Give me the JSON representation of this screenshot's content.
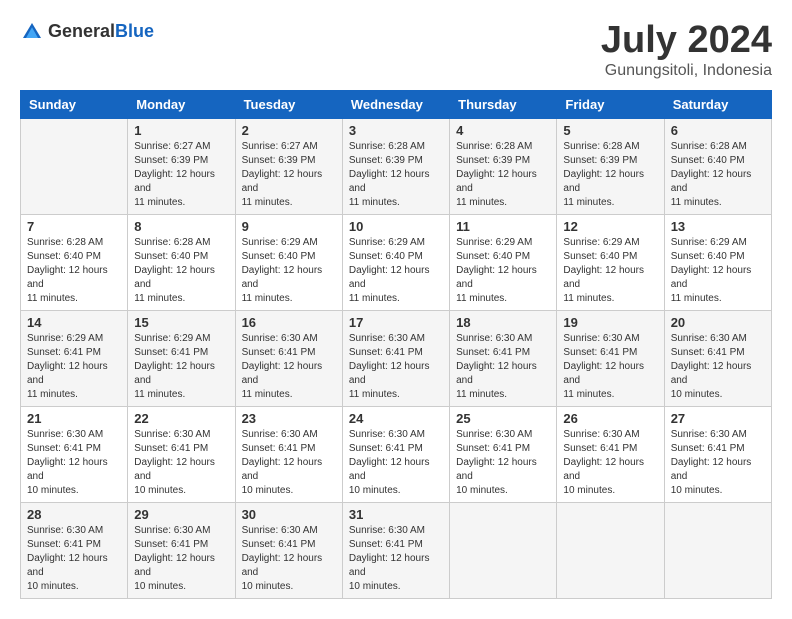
{
  "logo": {
    "general": "General",
    "blue": "Blue"
  },
  "title": {
    "month_year": "July 2024",
    "location": "Gunungsitoli, Indonesia"
  },
  "days_of_week": [
    "Sunday",
    "Monday",
    "Tuesday",
    "Wednesday",
    "Thursday",
    "Friday",
    "Saturday"
  ],
  "weeks": [
    [
      {
        "day": "",
        "sunrise": "",
        "sunset": "",
        "daylight": ""
      },
      {
        "day": "1",
        "sunrise": "Sunrise: 6:27 AM",
        "sunset": "Sunset: 6:39 PM",
        "daylight": "Daylight: 12 hours and 11 minutes."
      },
      {
        "day": "2",
        "sunrise": "Sunrise: 6:27 AM",
        "sunset": "Sunset: 6:39 PM",
        "daylight": "Daylight: 12 hours and 11 minutes."
      },
      {
        "day": "3",
        "sunrise": "Sunrise: 6:28 AM",
        "sunset": "Sunset: 6:39 PM",
        "daylight": "Daylight: 12 hours and 11 minutes."
      },
      {
        "day": "4",
        "sunrise": "Sunrise: 6:28 AM",
        "sunset": "Sunset: 6:39 PM",
        "daylight": "Daylight: 12 hours and 11 minutes."
      },
      {
        "day": "5",
        "sunrise": "Sunrise: 6:28 AM",
        "sunset": "Sunset: 6:39 PM",
        "daylight": "Daylight: 12 hours and 11 minutes."
      },
      {
        "day": "6",
        "sunrise": "Sunrise: 6:28 AM",
        "sunset": "Sunset: 6:40 PM",
        "daylight": "Daylight: 12 hours and 11 minutes."
      }
    ],
    [
      {
        "day": "7",
        "sunrise": "Sunrise: 6:28 AM",
        "sunset": "Sunset: 6:40 PM",
        "daylight": "Daylight: 12 hours and 11 minutes."
      },
      {
        "day": "8",
        "sunrise": "Sunrise: 6:28 AM",
        "sunset": "Sunset: 6:40 PM",
        "daylight": "Daylight: 12 hours and 11 minutes."
      },
      {
        "day": "9",
        "sunrise": "Sunrise: 6:29 AM",
        "sunset": "Sunset: 6:40 PM",
        "daylight": "Daylight: 12 hours and 11 minutes."
      },
      {
        "day": "10",
        "sunrise": "Sunrise: 6:29 AM",
        "sunset": "Sunset: 6:40 PM",
        "daylight": "Daylight: 12 hours and 11 minutes."
      },
      {
        "day": "11",
        "sunrise": "Sunrise: 6:29 AM",
        "sunset": "Sunset: 6:40 PM",
        "daylight": "Daylight: 12 hours and 11 minutes."
      },
      {
        "day": "12",
        "sunrise": "Sunrise: 6:29 AM",
        "sunset": "Sunset: 6:40 PM",
        "daylight": "Daylight: 12 hours and 11 minutes."
      },
      {
        "day": "13",
        "sunrise": "Sunrise: 6:29 AM",
        "sunset": "Sunset: 6:40 PM",
        "daylight": "Daylight: 12 hours and 11 minutes."
      }
    ],
    [
      {
        "day": "14",
        "sunrise": "Sunrise: 6:29 AM",
        "sunset": "Sunset: 6:41 PM",
        "daylight": "Daylight: 12 hours and 11 minutes."
      },
      {
        "day": "15",
        "sunrise": "Sunrise: 6:29 AM",
        "sunset": "Sunset: 6:41 PM",
        "daylight": "Daylight: 12 hours and 11 minutes."
      },
      {
        "day": "16",
        "sunrise": "Sunrise: 6:30 AM",
        "sunset": "Sunset: 6:41 PM",
        "daylight": "Daylight: 12 hours and 11 minutes."
      },
      {
        "day": "17",
        "sunrise": "Sunrise: 6:30 AM",
        "sunset": "Sunset: 6:41 PM",
        "daylight": "Daylight: 12 hours and 11 minutes."
      },
      {
        "day": "18",
        "sunrise": "Sunrise: 6:30 AM",
        "sunset": "Sunset: 6:41 PM",
        "daylight": "Daylight: 12 hours and 11 minutes."
      },
      {
        "day": "19",
        "sunrise": "Sunrise: 6:30 AM",
        "sunset": "Sunset: 6:41 PM",
        "daylight": "Daylight: 12 hours and 11 minutes."
      },
      {
        "day": "20",
        "sunrise": "Sunrise: 6:30 AM",
        "sunset": "Sunset: 6:41 PM",
        "daylight": "Daylight: 12 hours and 10 minutes."
      }
    ],
    [
      {
        "day": "21",
        "sunrise": "Sunrise: 6:30 AM",
        "sunset": "Sunset: 6:41 PM",
        "daylight": "Daylight: 12 hours and 10 minutes."
      },
      {
        "day": "22",
        "sunrise": "Sunrise: 6:30 AM",
        "sunset": "Sunset: 6:41 PM",
        "daylight": "Daylight: 12 hours and 10 minutes."
      },
      {
        "day": "23",
        "sunrise": "Sunrise: 6:30 AM",
        "sunset": "Sunset: 6:41 PM",
        "daylight": "Daylight: 12 hours and 10 minutes."
      },
      {
        "day": "24",
        "sunrise": "Sunrise: 6:30 AM",
        "sunset": "Sunset: 6:41 PM",
        "daylight": "Daylight: 12 hours and 10 minutes."
      },
      {
        "day": "25",
        "sunrise": "Sunrise: 6:30 AM",
        "sunset": "Sunset: 6:41 PM",
        "daylight": "Daylight: 12 hours and 10 minutes."
      },
      {
        "day": "26",
        "sunrise": "Sunrise: 6:30 AM",
        "sunset": "Sunset: 6:41 PM",
        "daylight": "Daylight: 12 hours and 10 minutes."
      },
      {
        "day": "27",
        "sunrise": "Sunrise: 6:30 AM",
        "sunset": "Sunset: 6:41 PM",
        "daylight": "Daylight: 12 hours and 10 minutes."
      }
    ],
    [
      {
        "day": "28",
        "sunrise": "Sunrise: 6:30 AM",
        "sunset": "Sunset: 6:41 PM",
        "daylight": "Daylight: 12 hours and 10 minutes."
      },
      {
        "day": "29",
        "sunrise": "Sunrise: 6:30 AM",
        "sunset": "Sunset: 6:41 PM",
        "daylight": "Daylight: 12 hours and 10 minutes."
      },
      {
        "day": "30",
        "sunrise": "Sunrise: 6:30 AM",
        "sunset": "Sunset: 6:41 PM",
        "daylight": "Daylight: 12 hours and 10 minutes."
      },
      {
        "day": "31",
        "sunrise": "Sunrise: 6:30 AM",
        "sunset": "Sunset: 6:41 PM",
        "daylight": "Daylight: 12 hours and 10 minutes."
      },
      {
        "day": "",
        "sunrise": "",
        "sunset": "",
        "daylight": ""
      },
      {
        "day": "",
        "sunrise": "",
        "sunset": "",
        "daylight": ""
      },
      {
        "day": "",
        "sunrise": "",
        "sunset": "",
        "daylight": ""
      }
    ]
  ]
}
